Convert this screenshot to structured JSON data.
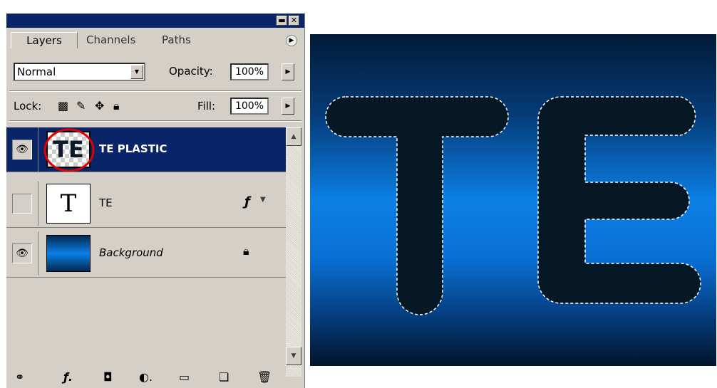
{
  "panel": {
    "tabs": [
      {
        "label": "Layers"
      },
      {
        "label": "Channels"
      },
      {
        "label": "Paths"
      }
    ],
    "blend_mode": "Normal",
    "opacity_label": "Opacity:",
    "opacity_value": "100%",
    "lock_label": "Lock:",
    "fill_label": "Fill:",
    "fill_value": "100%",
    "layers": [
      {
        "name": "TE PLASTIC",
        "thumb_text": "TE",
        "visible": true,
        "selected": true
      },
      {
        "name": "TE",
        "thumb_text": "T",
        "visible": false,
        "selected": false
      },
      {
        "name": "Background",
        "visible": true,
        "selected": false
      }
    ]
  },
  "canvas": {
    "text": "TE",
    "colors": {
      "text_fill": "#061826",
      "gradient_mid": "#0c7fe6",
      "gradient_edge": "#021a36"
    }
  }
}
